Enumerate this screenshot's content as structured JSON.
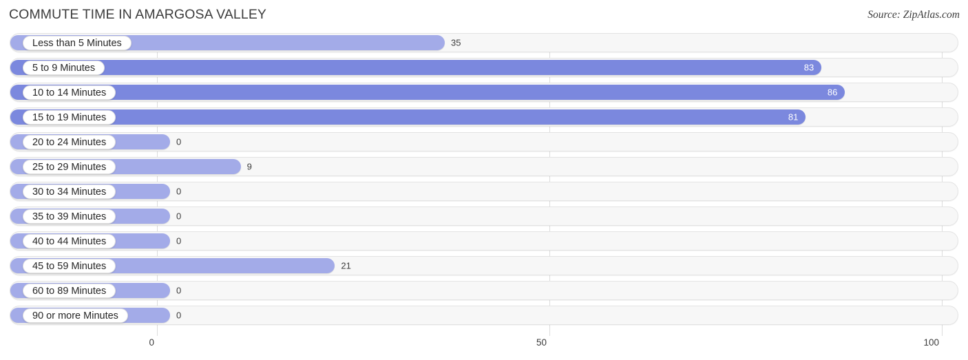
{
  "header": {
    "title": "COMMUTE TIME IN AMARGOSA VALLEY",
    "source": "Source: ZipAtlas.com"
  },
  "colors": {
    "bar_light": "#a3abe8",
    "bar_dark": "#7b88de",
    "track": "#f7f7f7",
    "gridline": "#dcdcdc",
    "text": "#3c3c3c"
  },
  "chart_data": {
    "type": "bar",
    "orientation": "horizontal",
    "title": "COMMUTE TIME IN AMARGOSA VALLEY",
    "xlabel": "",
    "ylabel": "",
    "xlim": [
      0,
      100
    ],
    "grid": true,
    "legend": "none",
    "axis_ticks": [
      "0",
      "50",
      "100"
    ],
    "axis_tick_values": [
      0,
      50,
      100
    ],
    "categories": [
      "Less than 5 Minutes",
      "5 to 9 Minutes",
      "10 to 14 Minutes",
      "15 to 19 Minutes",
      "20 to 24 Minutes",
      "25 to 29 Minutes",
      "30 to 34 Minutes",
      "35 to 39 Minutes",
      "40 to 44 Minutes",
      "45 to 59 Minutes",
      "60 to 89 Minutes",
      "90 or more Minutes"
    ],
    "values": [
      35,
      83,
      86,
      81,
      0,
      9,
      0,
      0,
      0,
      21,
      0,
      0
    ],
    "value_labels": [
      "35",
      "83",
      "86",
      "81",
      "0",
      "9",
      "0",
      "0",
      "0",
      "21",
      "0",
      "0"
    ]
  },
  "rows": [
    {
      "label": "Less than 5 Minutes",
      "value": 35,
      "value_label": "35",
      "tone": "light",
      "inside": false
    },
    {
      "label": "5 to 9 Minutes",
      "value": 83,
      "value_label": "83",
      "tone": "dark",
      "inside": true
    },
    {
      "label": "10 to 14 Minutes",
      "value": 86,
      "value_label": "86",
      "tone": "dark",
      "inside": true
    },
    {
      "label": "15 to 19 Minutes",
      "value": 81,
      "value_label": "81",
      "tone": "dark",
      "inside": true
    },
    {
      "label": "20 to 24 Minutes",
      "value": 0,
      "value_label": "0",
      "tone": "light",
      "inside": false
    },
    {
      "label": "25 to 29 Minutes",
      "value": 9,
      "value_label": "9",
      "tone": "light",
      "inside": false
    },
    {
      "label": "30 to 34 Minutes",
      "value": 0,
      "value_label": "0",
      "tone": "light",
      "inside": false
    },
    {
      "label": "35 to 39 Minutes",
      "value": 0,
      "value_label": "0",
      "tone": "light",
      "inside": false
    },
    {
      "label": "40 to 44 Minutes",
      "value": 0,
      "value_label": "0",
      "tone": "light",
      "inside": false
    },
    {
      "label": "45 to 59 Minutes",
      "value": 21,
      "value_label": "21",
      "tone": "light",
      "inside": false
    },
    {
      "label": "60 to 89 Minutes",
      "value": 0,
      "value_label": "0",
      "tone": "light",
      "inside": false
    },
    {
      "label": "90 or more Minutes",
      "value": 0,
      "value_label": "0",
      "tone": "light",
      "inside": false
    }
  ],
  "axis": {
    "ticks": [
      {
        "label": "0",
        "value": 0
      },
      {
        "label": "50",
        "value": 50
      },
      {
        "label": "100",
        "value": 100
      }
    ]
  }
}
